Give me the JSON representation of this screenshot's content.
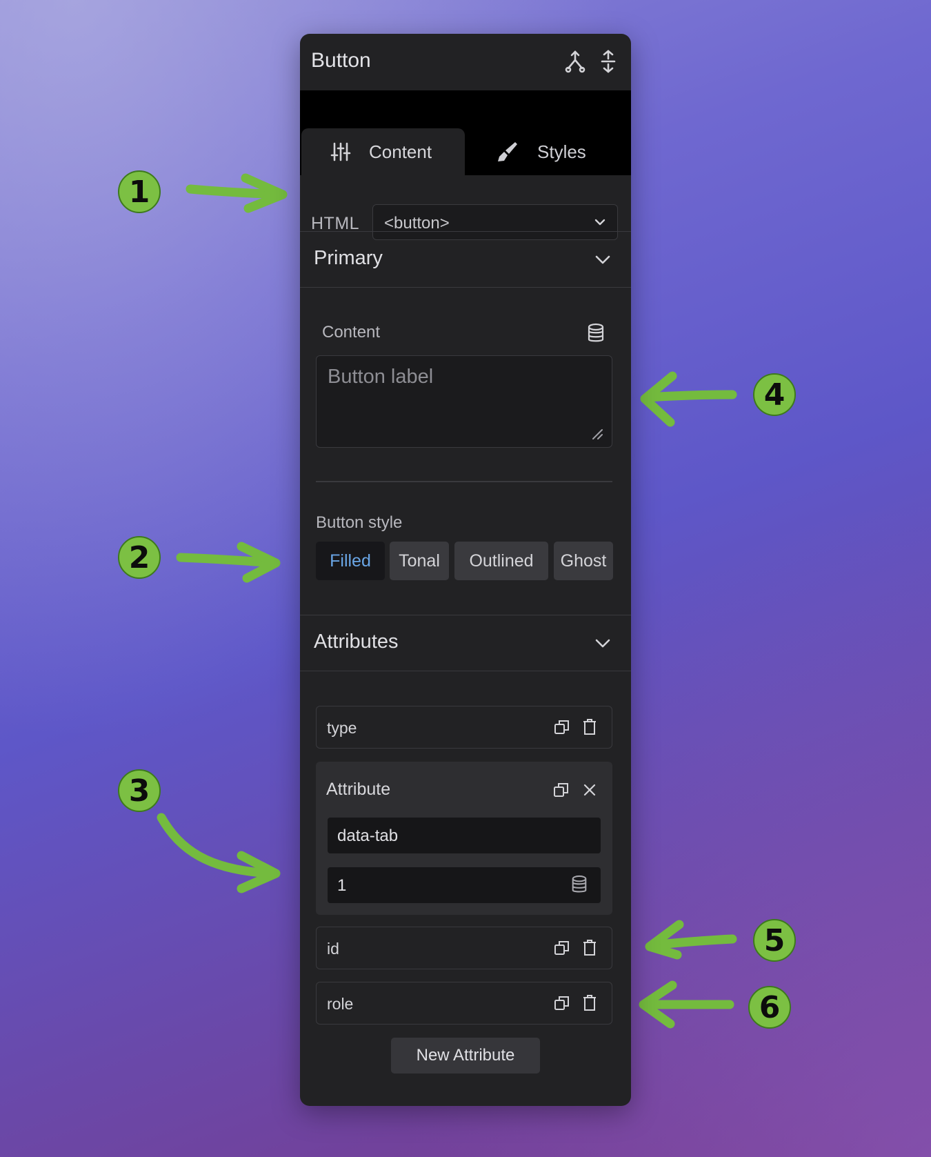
{
  "panel": {
    "title": "Button",
    "header_icons": [
      "branch-icon",
      "expand-vertical-icon"
    ]
  },
  "tabs": [
    {
      "label": "Content",
      "icon": "sliders-icon",
      "active": true
    },
    {
      "label": "Styles",
      "icon": "paintbrush-icon",
      "active": false
    }
  ],
  "html_field": {
    "label": "HTML",
    "value": "<button>"
  },
  "primary_section": {
    "title": "Primary",
    "content_label": "Content",
    "content_placeholder": "Button label",
    "button_style_label": "Button style",
    "button_styles": [
      "Filled",
      "Tonal",
      "Outlined",
      "Ghost"
    ],
    "selected_style": "Filled"
  },
  "attributes_section": {
    "title": "Attributes",
    "rows": [
      {
        "name": "type"
      },
      {
        "name": "id"
      },
      {
        "name": "role"
      }
    ],
    "expanded": {
      "title": "Attribute",
      "name_value": "data-tab",
      "value": "1"
    },
    "new_button": "New Attribute"
  },
  "callouts": [
    "1",
    "2",
    "3",
    "4",
    "5",
    "6"
  ],
  "colors": {
    "panel_bg": "#222224",
    "accent_selected": "#6aa6e6",
    "callout_green": "#7cc043"
  }
}
